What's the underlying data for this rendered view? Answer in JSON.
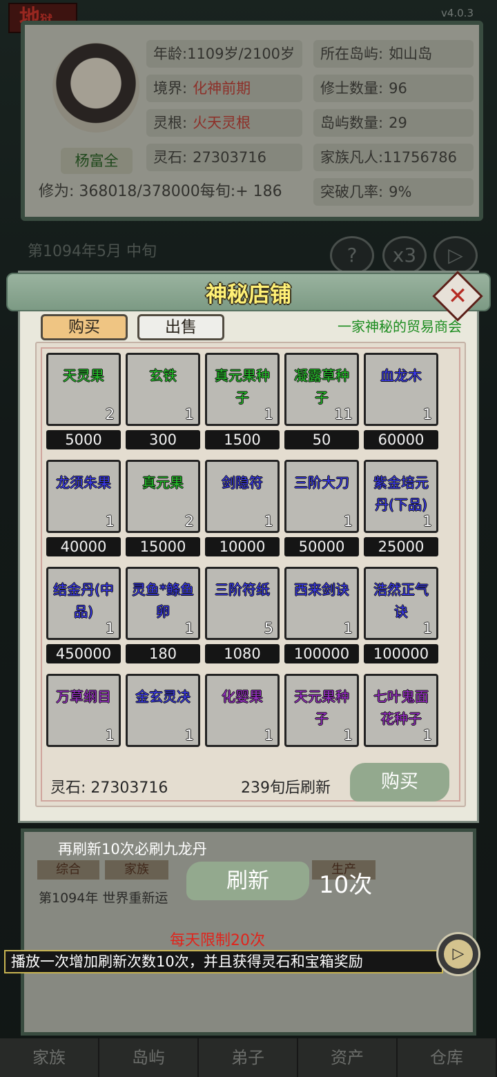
{
  "background": {
    "region": "地",
    "region_sub": "狱",
    "version": "v4.0.3",
    "player": {
      "name": "杨富全",
      "age_label": "年龄:",
      "age_value": "1109岁/2100岁",
      "realm_label": "境界:",
      "realm_value": "化神前期",
      "root_label": "灵根:",
      "root_value": "火天灵根",
      "stone_label": "灵石:",
      "stone_value": "27303716",
      "cultivation": "修为: 368018/378000每旬:+ 186",
      "island_label": "所在岛屿:",
      "island_value": "如山岛",
      "cultivators_label": "修士数量:",
      "cultivators_value": "96",
      "islands_label": "岛屿数量:",
      "islands_value": "29",
      "mortals_label": "家族凡人:",
      "mortals_value": "11756786",
      "breakthrough_label": "突破几率:",
      "breakthrough_value": "9%"
    },
    "date": "第1094年5月 中旬",
    "buttons": {
      "help": "?",
      "speed": "x3",
      "play": "▷"
    },
    "log_tabs": [
      "综合",
      "家族",
      "",
      "生产"
    ],
    "log_line": "第1094年 世界重新运",
    "nav": [
      "家族",
      "岛屿",
      "弟子",
      "资产",
      "仓库"
    ]
  },
  "shop": {
    "title": "神秘店铺",
    "close_icon": "✕",
    "tabs": {
      "buy": "购买",
      "sell": "出售"
    },
    "slogan": "一家神秘的贸易商会",
    "items": [
      {
        "name": "天灵果",
        "qty": "2",
        "price": "5000",
        "color": "#25c22a"
      },
      {
        "name": "玄铁",
        "qty": "1",
        "price": "300",
        "color": "#25c22a"
      },
      {
        "name": "真元果种子",
        "qty": "1",
        "price": "1500",
        "color": "#25c22a"
      },
      {
        "name": "凝露草种子",
        "qty": "11",
        "price": "50",
        "color": "#25c22a"
      },
      {
        "name": "血龙木",
        "qty": "1",
        "price": "60000",
        "color": "#3a3aee"
      },
      {
        "name": "龙须朱果",
        "qty": "1",
        "price": "40000",
        "color": "#3a3aee"
      },
      {
        "name": "真元果",
        "qty": "2",
        "price": "15000",
        "color": "#25c22a"
      },
      {
        "name": "剑隐符",
        "qty": "1",
        "price": "10000",
        "color": "#3a3aee"
      },
      {
        "name": "三阶大刀",
        "qty": "1",
        "price": "50000",
        "color": "#3a3aee"
      },
      {
        "name": "紫金培元丹(下品)",
        "qty": "1",
        "price": "25000",
        "color": "#3a3aee"
      },
      {
        "name": "结金丹(中品)",
        "qty": "1",
        "price": "450000",
        "color": "#3a3aee"
      },
      {
        "name": "灵鱼*鲦鱼卵",
        "qty": "1",
        "price": "180",
        "color": "#3a3aee"
      },
      {
        "name": "三阶符纸",
        "qty": "5",
        "price": "1080",
        "color": "#3a3aee"
      },
      {
        "name": "西来剑诀",
        "qty": "1",
        "price": "100000",
        "color": "#3a3aee"
      },
      {
        "name": "浩然正气诀",
        "qty": "1",
        "price": "100000",
        "color": "#3a3aee"
      },
      {
        "name": "万草纲目",
        "qty": "1",
        "price": "",
        "color": "#9b2ec9"
      },
      {
        "name": "金玄灵决",
        "qty": "1",
        "price": "",
        "color": "#3a3aee"
      },
      {
        "name": "化婴果",
        "qty": "1",
        "price": "",
        "color": "#9b2ec9"
      },
      {
        "name": "天元果种子",
        "qty": "1",
        "price": "",
        "color": "#9b2ec9"
      },
      {
        "name": "七叶鬼面花种子",
        "qty": "1",
        "price": "",
        "color": "#9b2ec9"
      }
    ],
    "spirit_stones": "灵石: 27303716",
    "refresh_after": "239旬后刷新",
    "buy_button": "购买"
  },
  "refresh": {
    "hint": "再刷新10次必刷九龙丹",
    "button": "刷新",
    "count": "10次",
    "daily_limit": "每天限制20次",
    "video_text": "播放一次增加刷新次数10次，并且获得灵石和宝箱奖励",
    "play_icon": "▷"
  }
}
